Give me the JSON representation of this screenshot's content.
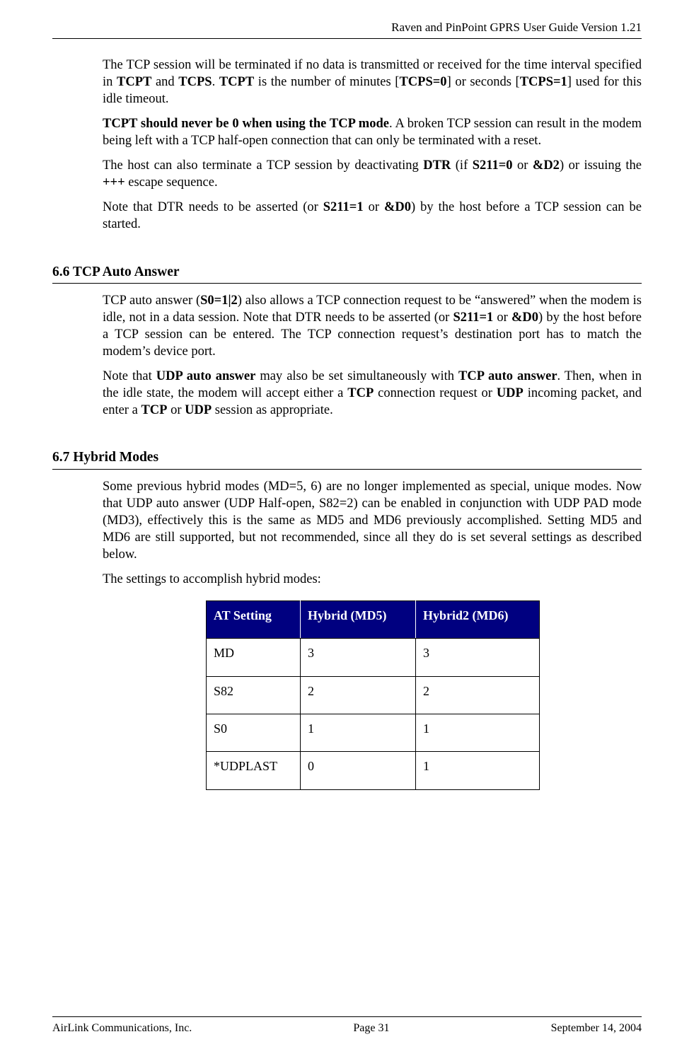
{
  "header": {
    "running_title": "Raven and PinPoint GPRS User Guide Version 1.21"
  },
  "body": {
    "p1_a": "The TCP session will be terminated if no data is transmitted or received for the time interval specified in ",
    "p1_b1": "TCPT",
    "p1_b": " and ",
    "p1_b2": "TCPS",
    "p1_c": ". ",
    "p1_b3": "TCPT",
    "p1_d": " is the number of minutes [",
    "p1_b4": "TCPS=0",
    "p1_e": "] or seconds [",
    "p1_b5": "TCPS=1",
    "p1_f": "] used for this idle timeout.",
    "p2_b1": "TCPT should never be 0 when using the TCP mode",
    "p2_a": ". A broken TCP session can result in the modem being left with a TCP half-open connection that can only be terminated with a reset.",
    "p3_a": "The host can also terminate a TCP session by deactivating ",
    "p3_b1": "DTR",
    "p3_b": " (if ",
    "p3_b2": "S211=0",
    "p3_c": " or ",
    "p3_b3": "&D2",
    "p3_d": ") or issuing the ",
    "p3_b4": "+++",
    "p3_e": "  escape sequence.",
    "p4_a": "Note that DTR needs to be asserted (or ",
    "p4_b1": "S211=1",
    "p4_b": " or ",
    "p4_b2": "&D0",
    "p4_c": ") by the host before a TCP session can be started."
  },
  "section66": {
    "heading": "6.6   TCP Auto Answer",
    "p1_a": "TCP auto answer (",
    "p1_b1": "S0=1|2",
    "p1_b": ") also allows a TCP connection request to be “answered” when the modem is idle, not in a data session. Note that DTR needs to be asserted (or ",
    "p1_b2": "S211=1",
    "p1_c": " or ",
    "p1_b3": "&D0",
    "p1_d": ") by the host before a TCP session can be entered. The TCP connection request’s destination port has to match the modem’s device port.",
    "p2_a": "Note that ",
    "p2_b1": "UDP auto answer",
    "p2_b": " may also be set simultaneously with ",
    "p2_b2": "TCP auto answer",
    "p2_c": ". Then, when in the idle state, the modem will accept either a ",
    "p2_b3": "TCP",
    "p2_d": " connection request or ",
    "p2_b4": "UDP",
    "p2_e": " incoming packet, and enter a ",
    "p2_b5": "TCP",
    "p2_f": " or ",
    "p2_b6": "UDP",
    "p2_g": " session as appropriate."
  },
  "section67": {
    "heading": "6.7   Hybrid Modes",
    "p1": "Some previous hybrid modes (MD=5, 6) are no longer implemented as special, unique modes. Now that UDP auto answer (UDP Half-open, S82=2) can be enabled in conjunction with UDP PAD mode (MD3), effectively this is the same as MD5 and MD6 previously accomplished. Setting MD5 and MD6 are still supported, but not recommended, since all they do is set several settings as described below.",
    "p2": "The settings to accomplish hybrid modes:"
  },
  "table": {
    "headers": [
      "AT Setting",
      "Hybrid (MD5)",
      "Hybrid2 (MD6)"
    ],
    "rows": [
      [
        "MD",
        "3",
        "3"
      ],
      [
        "S82",
        "2",
        "2"
      ],
      [
        "S0",
        "1",
        "1"
      ],
      [
        "*UDPLAST",
        "0",
        "1"
      ]
    ]
  },
  "footer": {
    "left": "AirLink Communications, Inc.",
    "center": "Page 31",
    "right": "September 14, 2004"
  }
}
